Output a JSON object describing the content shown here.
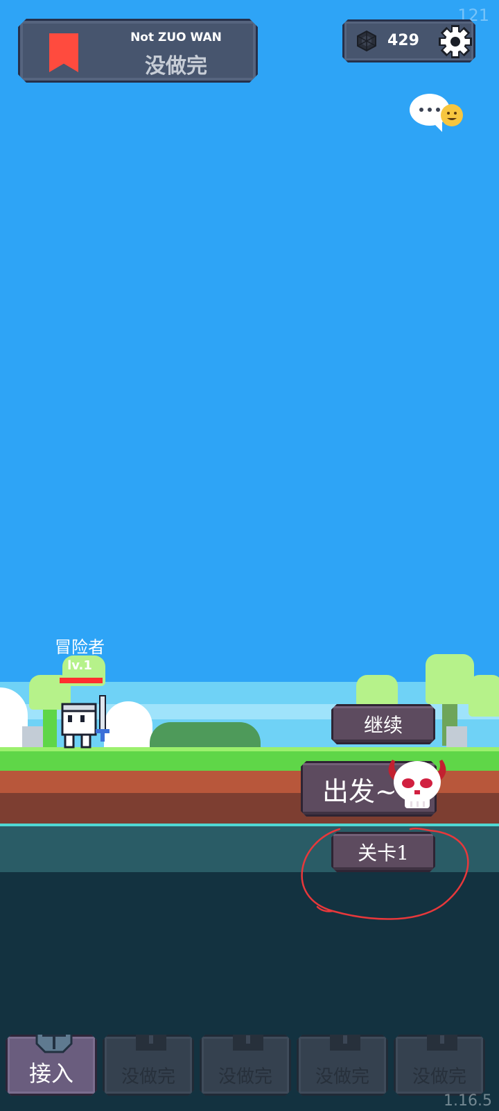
{
  "overlay": {
    "fps": "121",
    "version": "1.16.5"
  },
  "banner": {
    "title": "Not ZUO WAN",
    "subtitle": "没做完"
  },
  "currency": {
    "value": "429"
  },
  "hero": {
    "name": "冒险者",
    "level": "lv.1",
    "hp_fraction": 1.0
  },
  "actions": {
    "continue": "继续",
    "go": "出发~",
    "stage": "关卡1"
  },
  "tabs": [
    {
      "label": "接入",
      "icon": "knight-helmet-icon",
      "active": true
    },
    {
      "label": "没做完",
      "icon": "lock-icon",
      "active": false
    },
    {
      "label": "没做完",
      "icon": "lock-icon",
      "active": false
    },
    {
      "label": "没做完",
      "icon": "lock-icon",
      "active": false
    },
    {
      "label": "没做完",
      "icon": "lock-icon",
      "active": false
    }
  ],
  "colors": {
    "sky": "#2ea4f6",
    "bookmark": "#ff4b3e",
    "hp": "#ff2f2f",
    "grass": "#5fd648",
    "annotation": "#e8383b"
  }
}
